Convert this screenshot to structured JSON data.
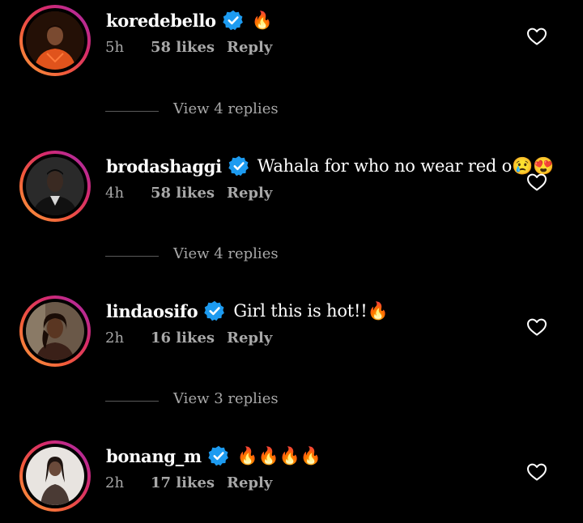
{
  "colors": {
    "background": "#000000",
    "text": "#ffffff",
    "muted": "#a8a8a8",
    "verified": "#1d9bf0",
    "story_ring": [
      "#f9a03f",
      "#f25a3a",
      "#d62a6b",
      "#a12bb2"
    ]
  },
  "comments": [
    {
      "username": "koredebello",
      "text": "🔥",
      "time": "5h",
      "likes": "58 likes",
      "reply": "Reply",
      "view_replies": "View 4 replies"
    },
    {
      "username": "brodashaggi",
      "text": "Wahala for who no wear red o😢😍",
      "time": "4h",
      "likes": "58 likes",
      "reply": "Reply",
      "view_replies": "View 4 replies"
    },
    {
      "username": "lindaosifo",
      "text": "Girl this is hot!!🔥",
      "time": "2h",
      "likes": "16 likes",
      "reply": "Reply",
      "view_replies": "View 3 replies"
    },
    {
      "username": "bonang_m",
      "text": "🔥🔥🔥🔥",
      "time": "2h",
      "likes": "17 likes",
      "reply": "Reply"
    }
  ],
  "icons": {
    "verified": "verified-badge-icon",
    "like": "heart-outline-icon"
  }
}
